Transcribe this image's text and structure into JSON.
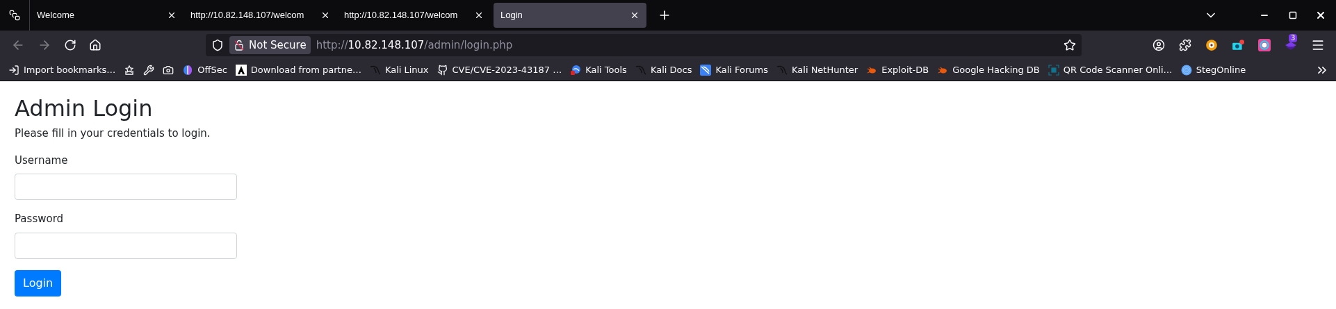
{
  "tabs": [
    {
      "title": "Welcome",
      "selected": false
    },
    {
      "title": "http://10.82.148.107/welcom",
      "selected": false
    },
    {
      "title": "http://10.82.148.107/welcom",
      "selected": false
    },
    {
      "title": "Login",
      "selected": true
    }
  ],
  "address_bar": {
    "security_label": "Not Secure",
    "url": {
      "scheme": "http://",
      "host": "10.82.148.107",
      "path": "/admin/login.php"
    }
  },
  "toolbar": {
    "badge": "3"
  },
  "bookmarks": [
    {
      "kind": "import",
      "label": "Import bookmarks…"
    },
    {
      "kind": "doc"
    },
    {
      "kind": "wrench"
    },
    {
      "kind": "camera"
    },
    {
      "kind": "offsec",
      "label": "OffSec"
    },
    {
      "kind": "letter",
      "label": "Download from partne…"
    },
    {
      "kind": "kali",
      "label": "Kali Linux"
    },
    {
      "kind": "github",
      "label": "CVE/CVE-2023-43187 …"
    },
    {
      "kind": "tools",
      "label": "Kali Tools"
    },
    {
      "kind": "kali",
      "label": "Kali Docs"
    },
    {
      "kind": "forums",
      "label": "Kali Forums"
    },
    {
      "kind": "kali",
      "label": "Kali NetHunter"
    },
    {
      "kind": "bug",
      "label": "Exploit-DB"
    },
    {
      "kind": "bug",
      "label": "Google Hacking DB"
    },
    {
      "kind": "qr",
      "label": "QR Code Scanner Onli…"
    },
    {
      "kind": "target",
      "label": "StegOnline"
    }
  ],
  "page": {
    "heading": "Admin Login",
    "intro": "Please fill in your credentials to login.",
    "fields": [
      {
        "label": "Username"
      },
      {
        "label": "Password"
      }
    ],
    "submit": "Login"
  }
}
